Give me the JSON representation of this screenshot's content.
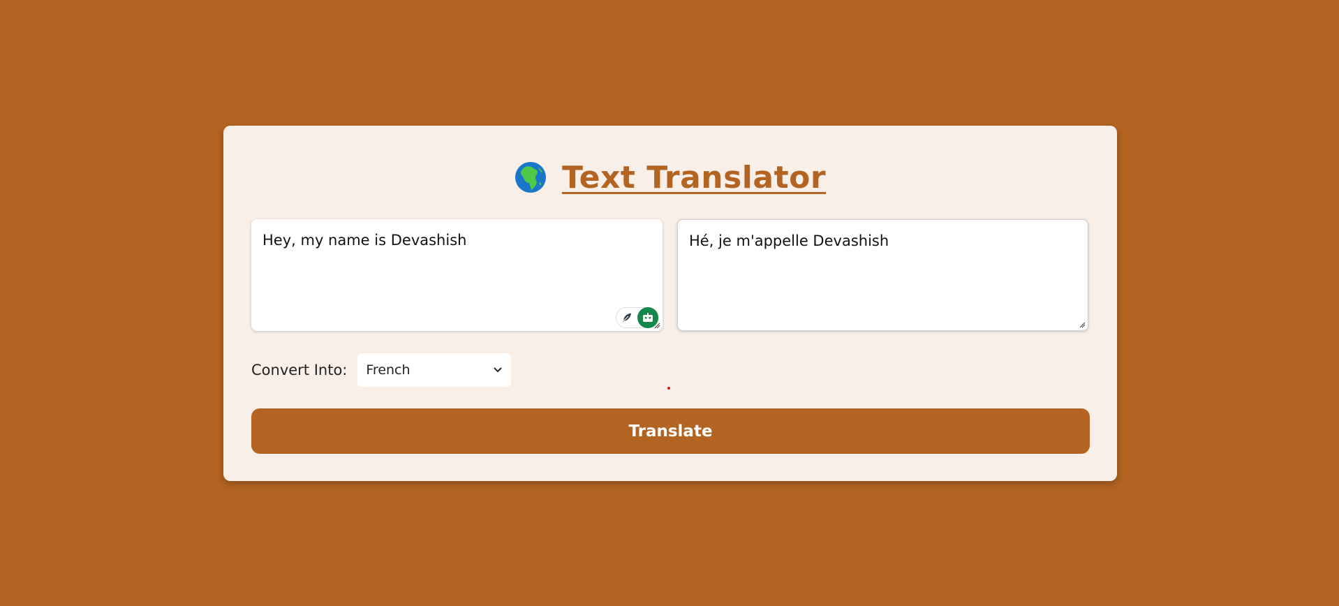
{
  "header": {
    "icon": "globe-africa-icon",
    "title": "Text Translator"
  },
  "source": {
    "value": "Hey, my name is Devashish"
  },
  "target": {
    "value": "Hé, je m'appelle Devashish"
  },
  "controls": {
    "convert_label": "Convert Into:",
    "language_selected": "French",
    "translate_label": "Translate"
  },
  "colors": {
    "background": "#b36422",
    "card": "#f9efe9",
    "accent": "#b36422",
    "extension_green": "#14874a"
  }
}
